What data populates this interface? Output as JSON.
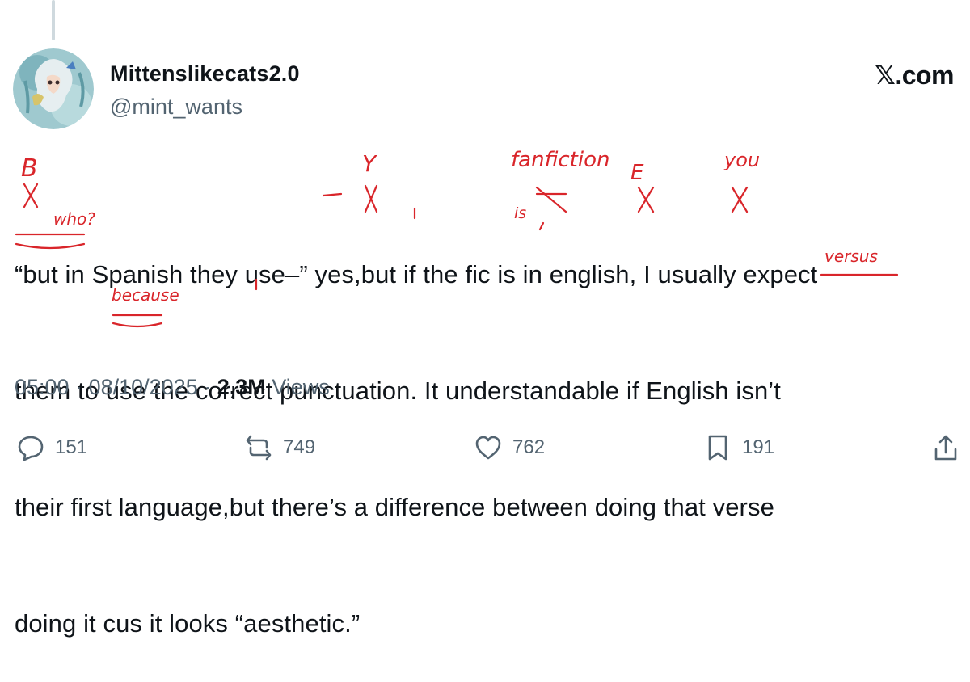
{
  "author": {
    "display_name": "Mittenslikecats2.0",
    "handle": "@mint_wants",
    "avatar_icon": "avatar-image"
  },
  "brand": {
    "x_glyph": "𝕏",
    "domain": ".com"
  },
  "tweet": {
    "lines": [
      "“but in Spanish they use–” yes,but if the fic is in english, I usually expect",
      "them to use the correct punctuation. It understandable if English isn’t",
      "their first language,but there’s a difference between doing that verse",
      "doing it cus it looks “aesthetic.”"
    ]
  },
  "annotations": {
    "b_cap": "B",
    "who": "who?",
    "y_cap": "Y",
    "fanfiction": "fanfiction",
    "e_cap": "E",
    "you": "you",
    "is": "is",
    "versus": "versus",
    "because": "because"
  },
  "meta": {
    "time": "05:00",
    "sep1": " · ",
    "date": "08/10/2025",
    "sep2": " · ",
    "views_count": "2,3M",
    "views_label": " Views"
  },
  "actions": {
    "replies": "151",
    "reposts": "749",
    "likes": "762",
    "bookmarks": "191"
  },
  "colors": {
    "text": "#0f1419",
    "secondary": "#536471",
    "annotation_red": "#d9252a",
    "thread_line": "#cfd9de"
  }
}
